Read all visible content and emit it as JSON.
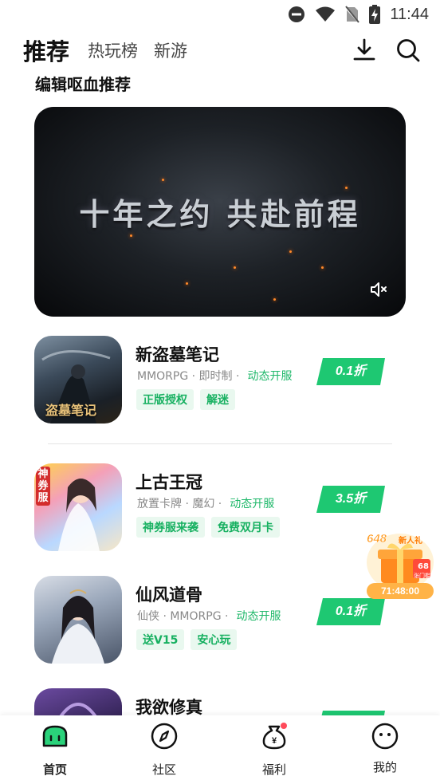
{
  "status_bar": {
    "time": "11:44"
  },
  "header": {
    "tabs": [
      {
        "label": "推荐",
        "active": true
      },
      {
        "label": "热玩榜",
        "active": false
      },
      {
        "label": "新游",
        "active": false
      }
    ],
    "icons": [
      "download-icon",
      "search-icon"
    ]
  },
  "section_title": "编辑呕血推荐",
  "banner": {
    "text": "十年之约 共赴前程",
    "icon": "mute-icon"
  },
  "games": [
    {
      "name": "新盗墓笔记",
      "genre": "MMORPG · 即时制 ·",
      "server": "动态开服",
      "tags": [
        "正版授权",
        "解迷"
      ],
      "discount": "0.1折",
      "icon_text": "盗墓笔记"
    },
    {
      "name": "上古王冠",
      "genre": "放置卡牌 · 魔幻 ·",
      "server": "动态开服",
      "tags": [
        "神券服来袭",
        "免费双月卡"
      ],
      "discount": "3.5折",
      "icon_text": "神券服"
    },
    {
      "name": "仙风道骨",
      "genre": "仙侠 · MMORPG ·",
      "server": "动态开服",
      "tags": [
        "送V15",
        "安心玩"
      ],
      "discount": "0.1折",
      "icon_text": ""
    },
    {
      "name": "我欲修真",
      "genre": "",
      "server": "",
      "tags": [],
      "discount": "",
      "icon_text": ""
    }
  ],
  "gift": {
    "amount": "648",
    "label": "新人礼",
    "badge": "68",
    "badge_sub": "张门槛",
    "timer": "71:48:00"
  },
  "bottom_nav": [
    {
      "label": "首页",
      "icon": "home-icon",
      "active": true
    },
    {
      "label": "社区",
      "icon": "compass-icon",
      "active": false
    },
    {
      "label": "福利",
      "icon": "money-bag-icon",
      "active": false
    },
    {
      "label": "我的",
      "icon": "profile-face-icon",
      "active": false
    }
  ],
  "colors": {
    "accent": "#1fc06e",
    "discount_green": "#1ec872",
    "tag_bg": "#e9f8ef"
  }
}
